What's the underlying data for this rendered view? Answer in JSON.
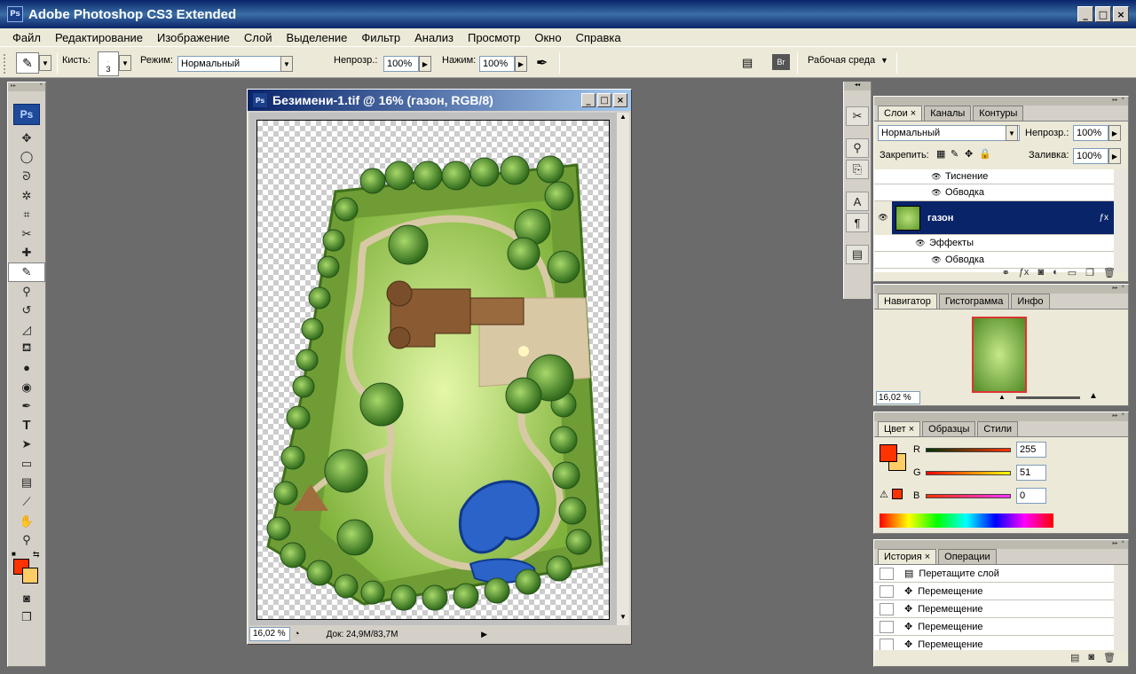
{
  "window": {
    "title": "Adobe Photoshop CS3 Extended",
    "app_icon": "Ps"
  },
  "menu": [
    "Файл",
    "Редактирование",
    "Изображение",
    "Слой",
    "Выделение",
    "Фильтр",
    "Анализ",
    "Просмотр",
    "Окно",
    "Справка"
  ],
  "options": {
    "brush_label": "Кисть:",
    "brush_size": "3",
    "mode_label": "Режим:",
    "mode_value": "Нормальный",
    "opacity_label": "Непрозр.:",
    "opacity_value": "100%",
    "flow_label": "Нажим:",
    "flow_value": "100%",
    "workspace_label": "Рабочая среда"
  },
  "toolbox": {
    "logo": "Ps"
  },
  "document": {
    "title": "Безимени-1.tif @ 16% (газон, RGB/8)",
    "zoom": "16,02 %",
    "doc_info": "Док: 24,9M/83,7M"
  },
  "layers_panel": {
    "tabs": [
      "Слои",
      "Каналы",
      "Контуры"
    ],
    "blend_mode": "Нормальный",
    "opacity_label": "Непрозр.:",
    "opacity_value": "100%",
    "lock_label": "Закрепить:",
    "fill_label": "Заливка:",
    "fill_value": "100%",
    "rows": [
      {
        "label": "Тиснение",
        "type": "effect"
      },
      {
        "label": "Обводка",
        "type": "effect"
      },
      {
        "label": "газон",
        "type": "layer"
      },
      {
        "label": "Эффекты",
        "type": "effects-header"
      },
      {
        "label": "Обводка",
        "type": "effect"
      }
    ]
  },
  "navigator_panel": {
    "tabs": [
      "Навигатор",
      "Гистограмма",
      "Инфо"
    ],
    "zoom": "16,02 %"
  },
  "color_panel": {
    "tabs": [
      "Цвет",
      "Образцы",
      "Стили"
    ],
    "r_label": "R",
    "r_value": "255",
    "g_label": "G",
    "g_value": "51",
    "b_label": "B",
    "b_value": "0",
    "fg_color": "#ff3300",
    "bg_color": "#ffcc66"
  },
  "history_panel": {
    "tabs": [
      "История",
      "Операции"
    ],
    "items": [
      "Перетащите слой",
      "Перемещение",
      "Перемещение",
      "Перемещение",
      "Перемещение"
    ]
  }
}
